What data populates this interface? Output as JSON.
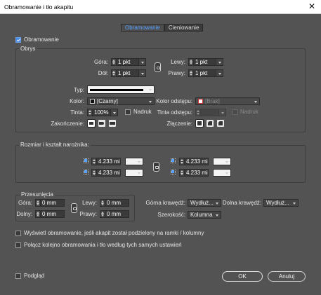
{
  "window": {
    "title": "Obramowanie i tło akapitu",
    "close_glyph": "✕"
  },
  "tabs": [
    {
      "label": "Obramowanie",
      "active": true
    },
    {
      "label": "Cieniowanie",
      "active": false
    }
  ],
  "enable": {
    "label": "Obramowanie",
    "checked": true
  },
  "stroke": {
    "title": "Obrys",
    "top": {
      "label": "Góra:",
      "value": "1 pkt"
    },
    "bottom": {
      "label": "Dół:",
      "value": "1 pkt"
    },
    "left": {
      "label": "Lewy:",
      "value": "1 pkt"
    },
    "right": {
      "label": "Prawy:",
      "value": "1 pkt"
    },
    "type_label": "Typ:",
    "color_label": "Kolor:",
    "color_value": "[Czarny]",
    "gap_color_label": "Kolor odstępu:",
    "gap_color_value": "[Brak]",
    "tint_label": "Tinta:",
    "tint_value": "100%",
    "overprint_label": "Nadruk",
    "gap_tint_label": "Tinta odstępu:",
    "gap_overprint_label": "Nadruk",
    "cap_label": "Zakończenie:",
    "join_label": "Złączenie:"
  },
  "corners": {
    "title": "Rozmiar i kształt narożnika:",
    "tl": "4.233 mi",
    "bl": "4.233 mi",
    "tr": "4.233 mi",
    "br": "4.233 mi"
  },
  "offsets": {
    "title": "Przesunięcia",
    "top": {
      "label": "Góra:",
      "value": "0 mm"
    },
    "bottom": {
      "label": "Dolny:",
      "value": "0 mm"
    },
    "left": {
      "label": "Lewy:",
      "value": "0 mm"
    },
    "right": {
      "label": "Prawy:",
      "value": "0 mm"
    }
  },
  "edges": {
    "top_label": "Górna krawędź:",
    "top_value": "Wydłuż...",
    "bottom_label": "Dolna krawędź:",
    "bottom_value": "Wydłuż...",
    "width_label": "Szerokość:",
    "width_value": "Kolumna"
  },
  "options": {
    "split_frames": "Wyświetl obramowanie, jeśli akapit został podzielony na ramki / kolumny",
    "merge": "Połącz kolejno obramowania i tło według tych samych ustawień"
  },
  "footer": {
    "preview_label": "Podgląd",
    "ok_label": "OK",
    "cancel_label": "Anuluj"
  },
  "colors": {
    "accent": "#5aa2ff",
    "background": "#535353"
  }
}
